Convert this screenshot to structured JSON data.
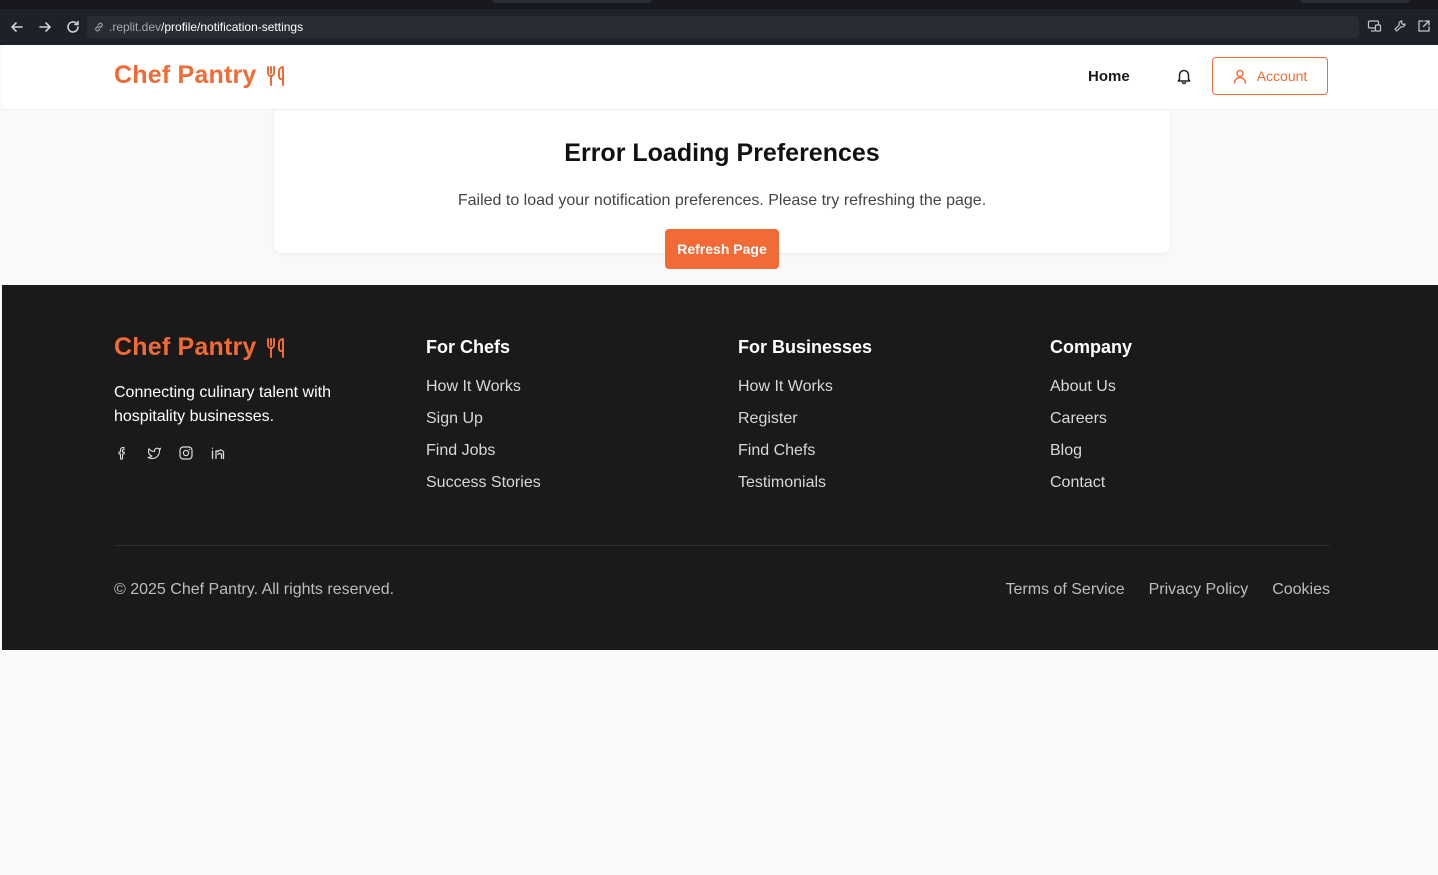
{
  "browser": {
    "url_domain": ".replit.dev",
    "url_path": "/profile/notification-settings"
  },
  "header": {
    "logo_text": "Chef Pantry",
    "home_label": "Home",
    "account_label": "Account"
  },
  "error_card": {
    "title": "Error Loading Preferences",
    "message": "Failed to load your notification preferences. Please try refreshing the page.",
    "button_label": "Refresh Page"
  },
  "footer": {
    "logo_text": "Chef Pantry",
    "description": "Connecting culinary talent with hospitality businesses.",
    "columns": [
      {
        "title": "For Chefs",
        "links": [
          "How It Works",
          "Sign Up",
          "Find Jobs",
          "Success Stories"
        ]
      },
      {
        "title": "For Businesses",
        "links": [
          "How It Works",
          "Register",
          "Find Chefs",
          "Testimonials"
        ]
      },
      {
        "title": "Company",
        "links": [
          "About Us",
          "Careers",
          "Blog",
          "Contact"
        ]
      }
    ],
    "copyright": "© 2025 Chef Pantry. All rights reserved.",
    "legal_links": [
      "Terms of Service",
      "Privacy Policy",
      "Cookies"
    ]
  },
  "colors": {
    "brand": "#f26a35",
    "footer_bg": "#1a1a1a",
    "page_bg": "#f9f9f9"
  },
  "icons": [
    "back-arrow-icon",
    "forward-arrow-icon",
    "reload-icon",
    "link-icon",
    "cast-icon",
    "wrench-icon",
    "external-link-icon",
    "utensils-icon",
    "bell-icon",
    "user-icon",
    "facebook-icon",
    "twitter-icon",
    "instagram-icon",
    "linkedin-icon"
  ]
}
